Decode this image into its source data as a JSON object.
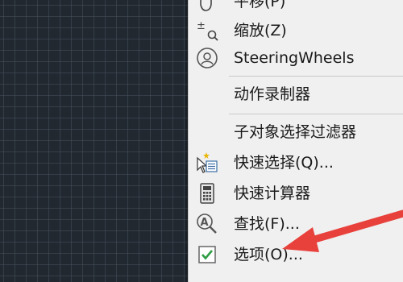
{
  "menu": {
    "items": [
      {
        "label": "平移(P)",
        "icon": "pan-hand-icon"
      },
      {
        "label": "缩放(Z)",
        "icon": "zoom-icon"
      },
      {
        "label": "SteeringWheels",
        "icon": "steering-wheel-icon"
      },
      {
        "label": "动作录制器",
        "icon": ""
      },
      {
        "label": "子对象选择过滤器",
        "icon": ""
      },
      {
        "label": "快速选择(Q)...",
        "icon": "quick-select-icon"
      },
      {
        "label": "快速计算器",
        "icon": "calculator-icon"
      },
      {
        "label": "查找(F)...",
        "icon": "find-icon"
      },
      {
        "label": "选项(O)...",
        "icon": "checkbox-checked-icon"
      }
    ]
  },
  "colors": {
    "canvas_bg": "#212830",
    "menu_bg": "#f0f0f0",
    "arrow": "#e8413c",
    "check_green": "#2f9e44"
  }
}
